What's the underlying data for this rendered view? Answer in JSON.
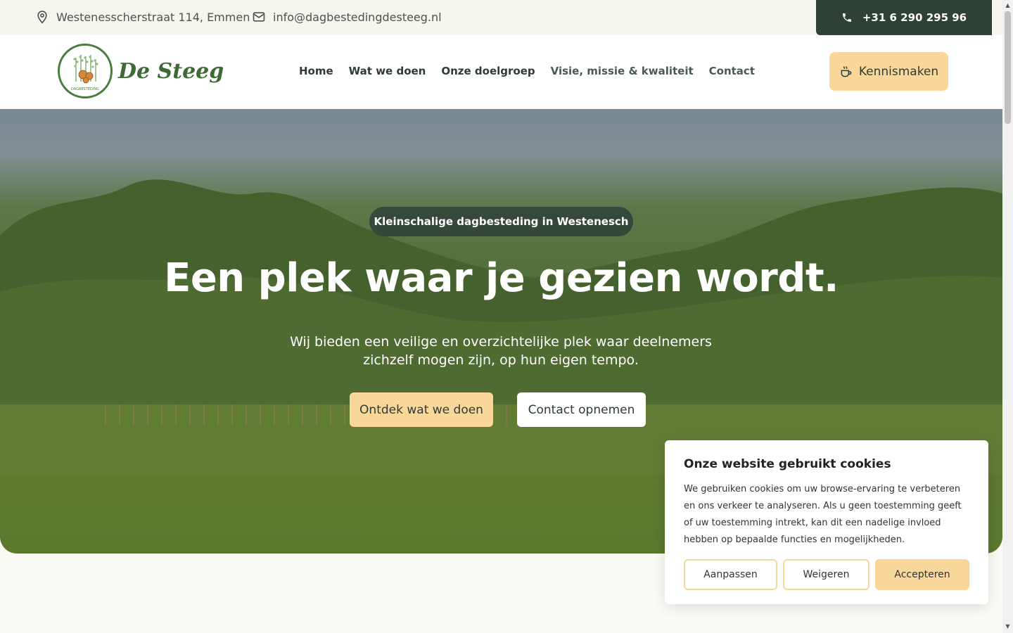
{
  "topbar": {
    "address": "Westenesscherstraat 114, Emmen",
    "email": "info@dagbestedingdesteeg.nl",
    "phone": "+31 6 290 295 96"
  },
  "header": {
    "logo_text": "De Steeg",
    "logo_ring_text": "DAGBESTEDING",
    "nav": [
      {
        "label": "Home"
      },
      {
        "label": "Wat we doen"
      },
      {
        "label": "Onze doelgroep"
      },
      {
        "label": "Visie, missie & kwaliteit"
      },
      {
        "label": "Contact"
      }
    ],
    "cta_label": "Kennismaken"
  },
  "hero": {
    "pill": "Kleinschalige dagbesteding in Westenesch",
    "title": "Een plek waar je gezien wordt.",
    "subtitle": "Wij bieden een veilige en overzichtelijke plek waar deelnemers zichzelf mogen zijn, op hun eigen tempo.",
    "primary_button": "Ontdek wat we doen",
    "secondary_button": "Contact opnemen"
  },
  "cookie": {
    "title": "Onze website gebruikt cookies",
    "text": "We gebruiken cookies om uw browse-ervaring te verbeteren en ons verkeer te analyseren. Als u geen toestemming geeft of uw toestemming intrekt, kan dit een nadelige invloed hebben op bepaalde functies en mogelijkheden.",
    "customize": "Aanpassen",
    "reject": "Weigeren",
    "accept": "Accepteren"
  },
  "colors": {
    "dark_green": "#2f4137",
    "accent_yellow": "#f9d79a",
    "logo_green": "#4b7c3c"
  }
}
